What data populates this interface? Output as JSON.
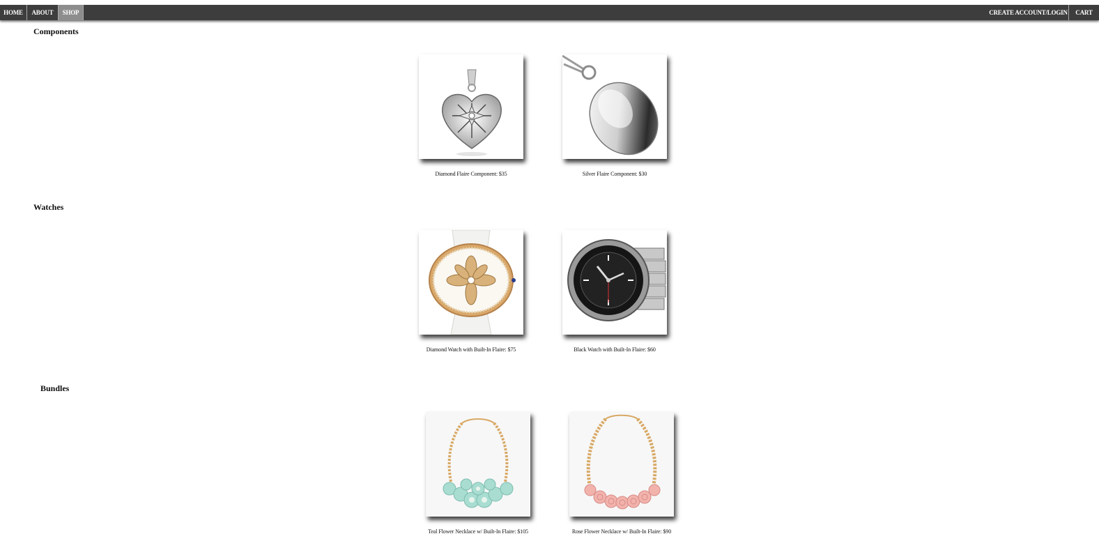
{
  "nav": {
    "home": "HOME",
    "about": "ABOUT",
    "shop": "SHOP",
    "account": "CREATE ACCOUNT/LOGIN",
    "cart": "CART"
  },
  "sections": [
    {
      "title": "Components",
      "products": [
        {
          "caption": "Diamond Flaire Component: $35",
          "icon": "diamond-heart-locket"
        },
        {
          "caption": "Silver Flaire Component: $30",
          "icon": "silver-oval-locket"
        }
      ]
    },
    {
      "title": "Watches",
      "products": [
        {
          "caption": "Diamond Watch with Built-In Flaire: $75",
          "icon": "diamond-flower-watch"
        },
        {
          "caption": "Black Watch with Built-In Flaire: $60",
          "icon": "black-steel-watch"
        }
      ]
    },
    {
      "title": "Bundles",
      "products": [
        {
          "caption": "Teal Flower Necklace w/ Built-In Flaire: $105",
          "icon": "teal-flower-necklace"
        },
        {
          "caption": "Rose Flower Necklace w/ Built-In Flaire: $90",
          "icon": "rose-flower-necklace"
        }
      ]
    }
  ],
  "colors": {
    "navbar": "#3d3d3d",
    "nav_active": "#8d8d8d",
    "nav_text": "#ffffff",
    "gold": "#d8a864",
    "teal_petal": "#a9ddd1",
    "rose_petal": "#f2b3ad"
  }
}
